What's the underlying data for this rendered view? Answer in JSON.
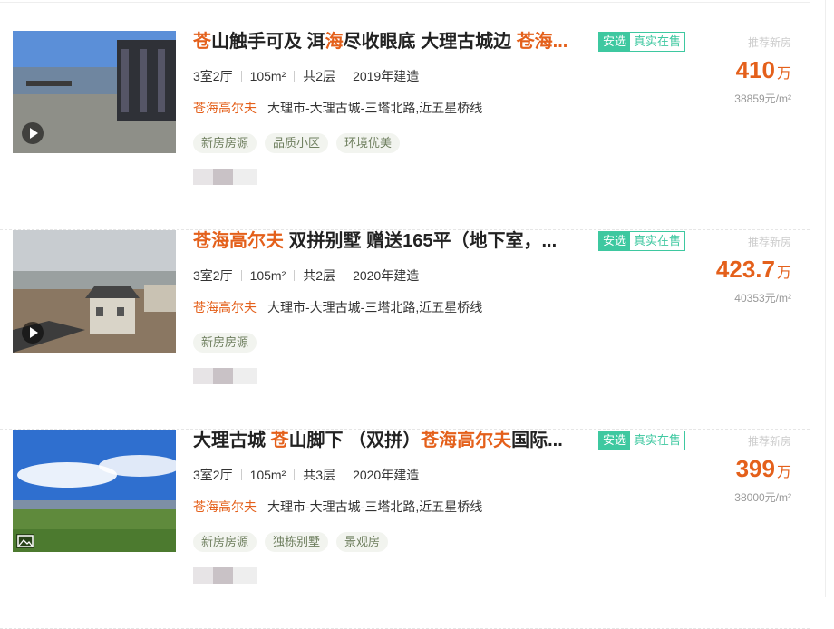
{
  "listings": [
    {
      "title_parts": [
        {
          "text": "苍",
          "hl": true
        },
        {
          "text": "山触手可及 洱",
          "hl": false
        },
        {
          "text": "海",
          "hl": true
        },
        {
          "text": "尽收眼底 大理古城边 ",
          "hl": false
        },
        {
          "text": "苍海...",
          "hl": true
        }
      ],
      "badge_select": "安选",
      "badge_real": "真实在售",
      "recommend": "推荐新房",
      "price": "410",
      "price_unit": "万",
      "unit_price": "38859元/m²",
      "layout": "3室2厅",
      "area": "105m²",
      "floors": "共2层",
      "built": "2019年建造",
      "community": "苍海高尔夫",
      "address": "大理市-大理古城-三塔北路,近五星桥线",
      "tags": [
        "新房房源",
        "品质小区",
        "环境优美"
      ],
      "media_icon": "play-icon",
      "colors": {
        "sky": "#5b8fd8",
        "ground": "#8e8f88",
        "wall": "#2f3137"
      }
    },
    {
      "title_parts": [
        {
          "text": "苍海高尔夫",
          "hl": true
        },
        {
          "text": " 双拼别墅 赠送165平（地下室，...",
          "hl": false
        }
      ],
      "badge_select": "安选",
      "badge_real": "真实在售",
      "recommend": "推荐新房",
      "price": "423.7",
      "price_unit": "万",
      "unit_price": "40353元/m²",
      "layout": "3室2厅",
      "area": "105m²",
      "floors": "共2层",
      "built": "2020年建造",
      "community": "苍海高尔夫",
      "address": "大理市-大理古城-三塔北路,近五星桥线",
      "tags": [
        "新房房源"
      ],
      "media_icon": "play-icon",
      "colors": {
        "sky": "#c8ccd0",
        "ground": "#8a7762",
        "wall": "#d9d4c8"
      }
    },
    {
      "title_parts": [
        {
          "text": "大理古城 ",
          "hl": false
        },
        {
          "text": "苍",
          "hl": true
        },
        {
          "text": "山脚下 （双拼）",
          "hl": false
        },
        {
          "text": "苍海高尔夫",
          "hl": true
        },
        {
          "text": "国际...",
          "hl": false
        }
      ],
      "badge_select": "安选",
      "badge_real": "真实在售",
      "recommend": "推荐新房",
      "price": "399",
      "price_unit": "万",
      "unit_price": "38000元/m²",
      "layout": "3室2厅",
      "area": "105m²",
      "floors": "共3层",
      "built": "2020年建造",
      "community": "苍海高尔夫",
      "address": "大理市-大理古城-三塔北路,近五星桥线",
      "tags": [
        "新房房源",
        "独栋别墅",
        "景观房"
      ],
      "media_icon": "picture-icon",
      "colors": {
        "sky": "#2f6fcf",
        "ground": "#5f8a3c",
        "wall": "#ffffff"
      }
    }
  ]
}
